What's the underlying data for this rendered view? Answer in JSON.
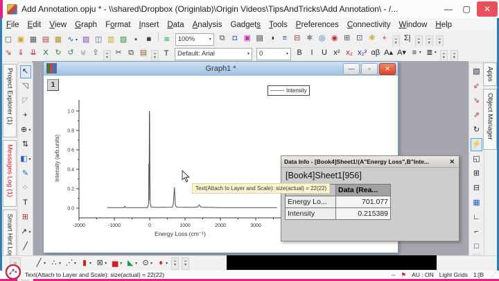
{
  "accent": {
    "magenta": "#e0218a",
    "frame_blue": "#2e7cb8"
  },
  "window": {
    "title": "Add Annotation.opju * - \\\\shared\\Dropbox (Originlab)\\Origin Videos\\TipsAndTricks\\Add Annotation\\ - /...",
    "controls": {
      "minimize": "—",
      "maximize": "▢",
      "close": "✕"
    }
  },
  "menu": {
    "items": [
      {
        "label": "File",
        "u": 0
      },
      {
        "label": "Edit",
        "u": 0
      },
      {
        "label": "View",
        "u": 0
      },
      {
        "label": "Graph",
        "u": 0
      },
      {
        "label": "Format",
        "u": 1
      },
      {
        "label": "Insert",
        "u": 0
      },
      {
        "label": "Data",
        "u": 0
      },
      {
        "label": "Analysis",
        "u": 0
      },
      {
        "label": "Gadgets",
        "u": 6
      },
      {
        "label": "Tools",
        "u": 0
      },
      {
        "label": "Preferences",
        "u": 0
      },
      {
        "label": "Connectivity",
        "u": 0
      },
      {
        "label": "Window",
        "u": 0
      },
      {
        "label": "Help",
        "u": 0
      }
    ]
  },
  "toolbar_top": {
    "zoom_value": "100%",
    "icons_left": [
      {
        "name": "new-project-button",
        "g": "▢",
        "c": "#555"
      },
      {
        "name": "new-folder-button",
        "g": "▣",
        "c": "#d2a42c"
      },
      {
        "name": "new-workbook-button",
        "g": "▦",
        "c": "#555"
      },
      {
        "name": "new-graph-button",
        "g": "▤",
        "c": "#b84040"
      },
      {
        "name": "new-matrix-button",
        "g": "▩",
        "c": "#b09a30"
      },
      {
        "name": "new-function-button",
        "g": "∿",
        "c": "#2b5fc4",
        "caret": true
      },
      {
        "name": "new-notes-button",
        "g": "▨",
        "c": "#8a4ab0"
      },
      {
        "name": "new-layout-button",
        "g": "◫",
        "c": "#4a6ab0"
      },
      {
        "name": "open-button",
        "g": "▥",
        "c": "#d2a42c"
      },
      {
        "name": "open-excel-button",
        "g": "▧",
        "c": "#2c8f4a"
      },
      {
        "name": "save-project-button",
        "g": "▪",
        "c": "#3a3a6a"
      },
      {
        "name": "save-template-button",
        "g": "◾",
        "c": "#3a3a6a"
      },
      {
        "sep": true
      },
      {
        "name": "digitizer-button",
        "g": "≋",
        "c": "#2c9f4a"
      }
    ],
    "icons_right": [
      {
        "name": "duplicate-window-button",
        "g": "⧉",
        "c": "#445566"
      },
      {
        "name": "screen-capture-button",
        "g": "◘",
        "c": "#2b6fc4"
      },
      {
        "name": "image-window-button",
        "g": "▣",
        "c": "#c22ba0"
      },
      {
        "name": "video-button",
        "g": "▤",
        "c": "#333333"
      },
      {
        "name": "contrast-button",
        "g": "◑",
        "c": "#222233"
      },
      {
        "name": "layout-lines-button",
        "g": "≡",
        "c": "#2b4fc4"
      },
      {
        "name": "merge-graph-button",
        "g": "⊟",
        "c": "#b03030"
      },
      {
        "name": "component-button",
        "g": "✱",
        "c": "#888888"
      },
      {
        "name": "find-button",
        "g": "◎",
        "c": "#2b6fc4"
      },
      {
        "name": "find-next-button",
        "g": "◉",
        "c": "#b03030"
      },
      {
        "name": "window-grid-button",
        "g": "⊞",
        "c": "#445566"
      },
      {
        "name": "window-chart-button",
        "g": "⊡",
        "c": "#445566"
      },
      {
        "name": "gears-button",
        "g": "❋",
        "c": "#c2a22c"
      },
      {
        "name": "add-button",
        "g": "+",
        "c": "#cc2222"
      },
      {
        "ovf": true
      },
      {
        "name": "sum-button",
        "g": "Σ|",
        "c": "#222233"
      },
      {
        "ovf": true
      },
      {
        "ovf": true
      },
      {
        "ovf": true
      }
    ]
  },
  "toolbar_import": {
    "icons": [
      {
        "name": "import-wizard-button",
        "g": "⇘",
        "c": "#b03030"
      },
      {
        "name": "import-ascii-button",
        "g": "⇓",
        "c": "#b03030"
      },
      {
        "name": "import-multiple-ascii-button",
        "g": "⇊",
        "c": "#b03030"
      },
      {
        "name": "import-excel-button",
        "g": "X",
        "c": "#1f5f2f"
      },
      {
        "name": "reimport-changed-button",
        "g": "↻",
        "c": "#2c8f4a"
      },
      {
        "name": "reimport-button",
        "g": "↺",
        "c": "#2c8f4a"
      },
      {
        "name": "import-database-button",
        "g": "⊎",
        "c": "#888888"
      },
      {
        "name": "import-clipboard-button",
        "g": "⇪",
        "c": "#555566"
      },
      {
        "ovf": true
      },
      {
        "name": "cut-button",
        "g": "✂",
        "c": "#444455"
      },
      {
        "name": "copy-button",
        "g": "⧉",
        "c": "#444455"
      },
      {
        "name": "paste-button",
        "g": "▤",
        "c": "#8a6a2a"
      },
      {
        "ovf": true
      }
    ]
  },
  "format": {
    "font_tool": "T",
    "font_name": "Default: Arial",
    "font_size": "0",
    "buttons": [
      {
        "name": "bold-button",
        "g": "B",
        "c": "#222222"
      },
      {
        "name": "italic-button",
        "g": "I",
        "c": "#222222"
      },
      {
        "name": "underline-button",
        "g": "U",
        "c": "#222222"
      },
      {
        "name": "superscript-button",
        "g": "x²",
        "c": "#222222"
      },
      {
        "name": "subscript-button",
        "g": "x₂",
        "c": "#aa2222"
      },
      {
        "name": "supersubscript-button",
        "g": "x₂²",
        "c": "#2222aa"
      },
      {
        "name": "greek-button",
        "g": "αβ",
        "c": "#222222"
      },
      {
        "name": "increase-font-button",
        "g": "A▴",
        "c": "#222222"
      },
      {
        "name": "decrease-font-button",
        "g": "A▾",
        "c": "#222222"
      },
      {
        "name": "align-button",
        "g": "≡",
        "c": "#222222",
        "caret": true
      },
      {
        "name": "spacing-button",
        "g": "≣",
        "c": "#222222",
        "caret": true
      },
      {
        "ovf": true
      },
      {
        "ovf": true
      }
    ]
  },
  "left_tabs": [
    {
      "label": "Project Explorer (1)",
      "c": "#222222"
    },
    {
      "label": "Messages Log (1)",
      "c": "#cc1111"
    },
    {
      "label": "Smart Hint Log",
      "c": "#222222"
    }
  ],
  "right_tabs": [
    {
      "label": "Apps",
      "c": "#222222"
    },
    {
      "label": "Object Manager",
      "c": "#222222"
    }
  ],
  "tools_left": [
    {
      "name": "pointer-tool",
      "g": "↖",
      "c": "#222233",
      "sel": true
    },
    {
      "name": "scale-in-tool",
      "g": "◹",
      "c": "#555566"
    },
    {
      "name": "scale-out-tool",
      "g": "◸",
      "c": "#9999aa"
    },
    {
      "name": "data-reader-tool",
      "g": "+",
      "c": "#222233"
    },
    {
      "name": "screen-reader-tool",
      "g": "⊕",
      "c": "#222233",
      "caret": true
    },
    {
      "name": "data-selector-tool",
      "g": "⇅",
      "c": "#222233"
    },
    {
      "name": "mask-tool",
      "g": "◧",
      "c": "#2b5fc4",
      "caret": true
    },
    {
      "name": "draw-tool",
      "g": "✎",
      "c": "#2b5fc4"
    },
    {
      "name": "region-select-tool",
      "g": "⁘",
      "c": "#555566"
    },
    {
      "name": "text-tool",
      "g": "T",
      "c": "#222233"
    },
    {
      "name": "equation-tool",
      "g": "⊞",
      "c": "#b03030"
    },
    {
      "name": "arrow-tool",
      "g": "↗",
      "c": "#222233",
      "caret": true
    },
    {
      "name": "line-tool",
      "g": "╱",
      "c": "#222233"
    },
    {
      "name": "shape-tool",
      "g": "◯",
      "c": "#555566",
      "caret": true
    },
    {
      "ovf": true
    }
  ],
  "tools_right": [
    {
      "name": "rescale-tool",
      "g": "▧",
      "c": "#222233"
    },
    {
      "name": "scale-in-axes-button",
      "g": "⇙",
      "c": "#b03030"
    },
    {
      "name": "scale-out-axes-button",
      "g": "⇘",
      "c": "#b03030"
    },
    {
      "name": "rescale-axes-button",
      "g": "⇗",
      "c": "#b03030"
    },
    {
      "name": "rotate-button",
      "g": "↻",
      "c": "#222233"
    },
    {
      "name": "annotation-tool-button",
      "g": "⚡",
      "c": "#b03030",
      "sel": true
    },
    {
      "name": "add-layer-button",
      "g": "◱",
      "c": "#222233"
    },
    {
      "name": "layer-grid-button",
      "g": "⊞",
      "c": "#222233"
    },
    {
      "name": "layer-grid2-button",
      "g": "⊟",
      "c": "#222233"
    },
    {
      "name": "merge-layers-button",
      "g": "▦",
      "c": "#2b5fc4"
    },
    {
      "name": "axes-bl-button",
      "g": "∟",
      "c": "#222233"
    },
    {
      "name": "axes-tl-button",
      "g": "⌐",
      "c": "#222233"
    },
    {
      "name": "axes-box-button",
      "g": "□",
      "c": "#222233"
    },
    {
      "ovf": true
    }
  ],
  "plot_toolbar": [
    {
      "name": "line-plot-button",
      "g": "╱",
      "c": "#222233",
      "caret": true
    },
    {
      "name": "scatter-plot-button",
      "g": "∴",
      "c": "#222233",
      "caret": true
    },
    {
      "name": "line-symbol-plot-button",
      "g": "⋰",
      "c": "#222233",
      "caret": true
    },
    {
      "name": "column-plot-button",
      "g": "▮",
      "c": "#cc2222",
      "caret": true
    },
    {
      "name": "special-plot-button",
      "g": "⊠",
      "c": "#444455",
      "caret": true
    },
    {
      "name": "bar-plot-button",
      "g": "▅",
      "c": "#cc2222",
      "caret": true
    },
    {
      "name": "area-plot-button",
      "g": "◣",
      "c": "#2c8f4a",
      "caret": true
    },
    {
      "name": "polar-plot-button",
      "g": "⊙",
      "c": "#222233",
      "caret": true
    },
    {
      "name": "stock-plot-button",
      "g": "♦",
      "c": "#cc2222",
      "caret": true
    },
    {
      "ovf": true
    },
    {
      "ovf": true
    }
  ],
  "graph_window": {
    "title": "Graph1 *",
    "layer_label": "1",
    "legend": "Intensity",
    "controls": {
      "minimize": "—",
      "maximize": "▫",
      "close": "✕"
    },
    "chart_data": {
      "type": "line",
      "title": "",
      "xlabel": "Energy Loss (cm⁻¹)",
      "ylabel": "Intensity (arb.units)",
      "xlim": [
        -2000,
        3700
      ],
      "ylim": [
        -0.1,
        1.1
      ],
      "xticks": [
        -2000,
        -1000,
        0,
        1000,
        2000,
        3000
      ],
      "yticks": [
        0.0,
        0.2,
        0.4,
        0.6,
        0.8,
        1.0
      ],
      "grid": false,
      "legend_position": "top-right",
      "series": [
        {
          "name": "Intensity",
          "color": "#4a4a4a",
          "points": [
            [
              -1200,
              0.005
            ],
            [
              -730,
              0.005
            ],
            [
              -705,
              0.02
            ],
            [
              -685,
              0.005
            ],
            [
              -400,
              0.005
            ],
            [
              -60,
              0.005
            ],
            [
              -30,
              0.05
            ],
            [
              -24,
              0.46
            ],
            [
              -18,
              0.08
            ],
            [
              -8,
              1.0
            ],
            [
              -2,
              0.97
            ],
            [
              6,
              0.3
            ],
            [
              16,
              0.05
            ],
            [
              40,
              0.01
            ],
            [
              300,
              0.008
            ],
            [
              640,
              0.01
            ],
            [
              668,
              0.04
            ],
            [
              700,
              0.215
            ],
            [
              726,
              0.03
            ],
            [
              765,
              0.01
            ],
            [
              1200,
              0.008
            ],
            [
              1360,
              0.012
            ],
            [
              1400,
              0.035
            ],
            [
              1450,
              0.01
            ],
            [
              2000,
              0.006
            ],
            [
              2800,
              0.006
            ],
            [
              3600,
              0.005
            ]
          ]
        }
      ]
    }
  },
  "tooltip": {
    "text": "Text(Attach to Layer and Scale): size(actual) = 22(22)"
  },
  "data_info": {
    "title": "Data Info - [Book4]Sheet1!(A\"Energy Loss\",B\"Inte...",
    "close": "✕",
    "subtitle": "[Book4]Sheet1[956]",
    "table": {
      "header": "Data (Rea...",
      "rows": [
        {
          "name": "Energy Lo...",
          "value": "701.077"
        },
        {
          "name": "Intensity",
          "value": "0.215389"
        }
      ]
    }
  },
  "status_bar": {
    "left": "Text(Attach to Layer and Scale): size(actual) = 22(22)",
    "dashes": "--",
    "flag": "⚑",
    "au": "AU : ON",
    "grids": "Light Grids",
    "book": "1:[B"
  }
}
